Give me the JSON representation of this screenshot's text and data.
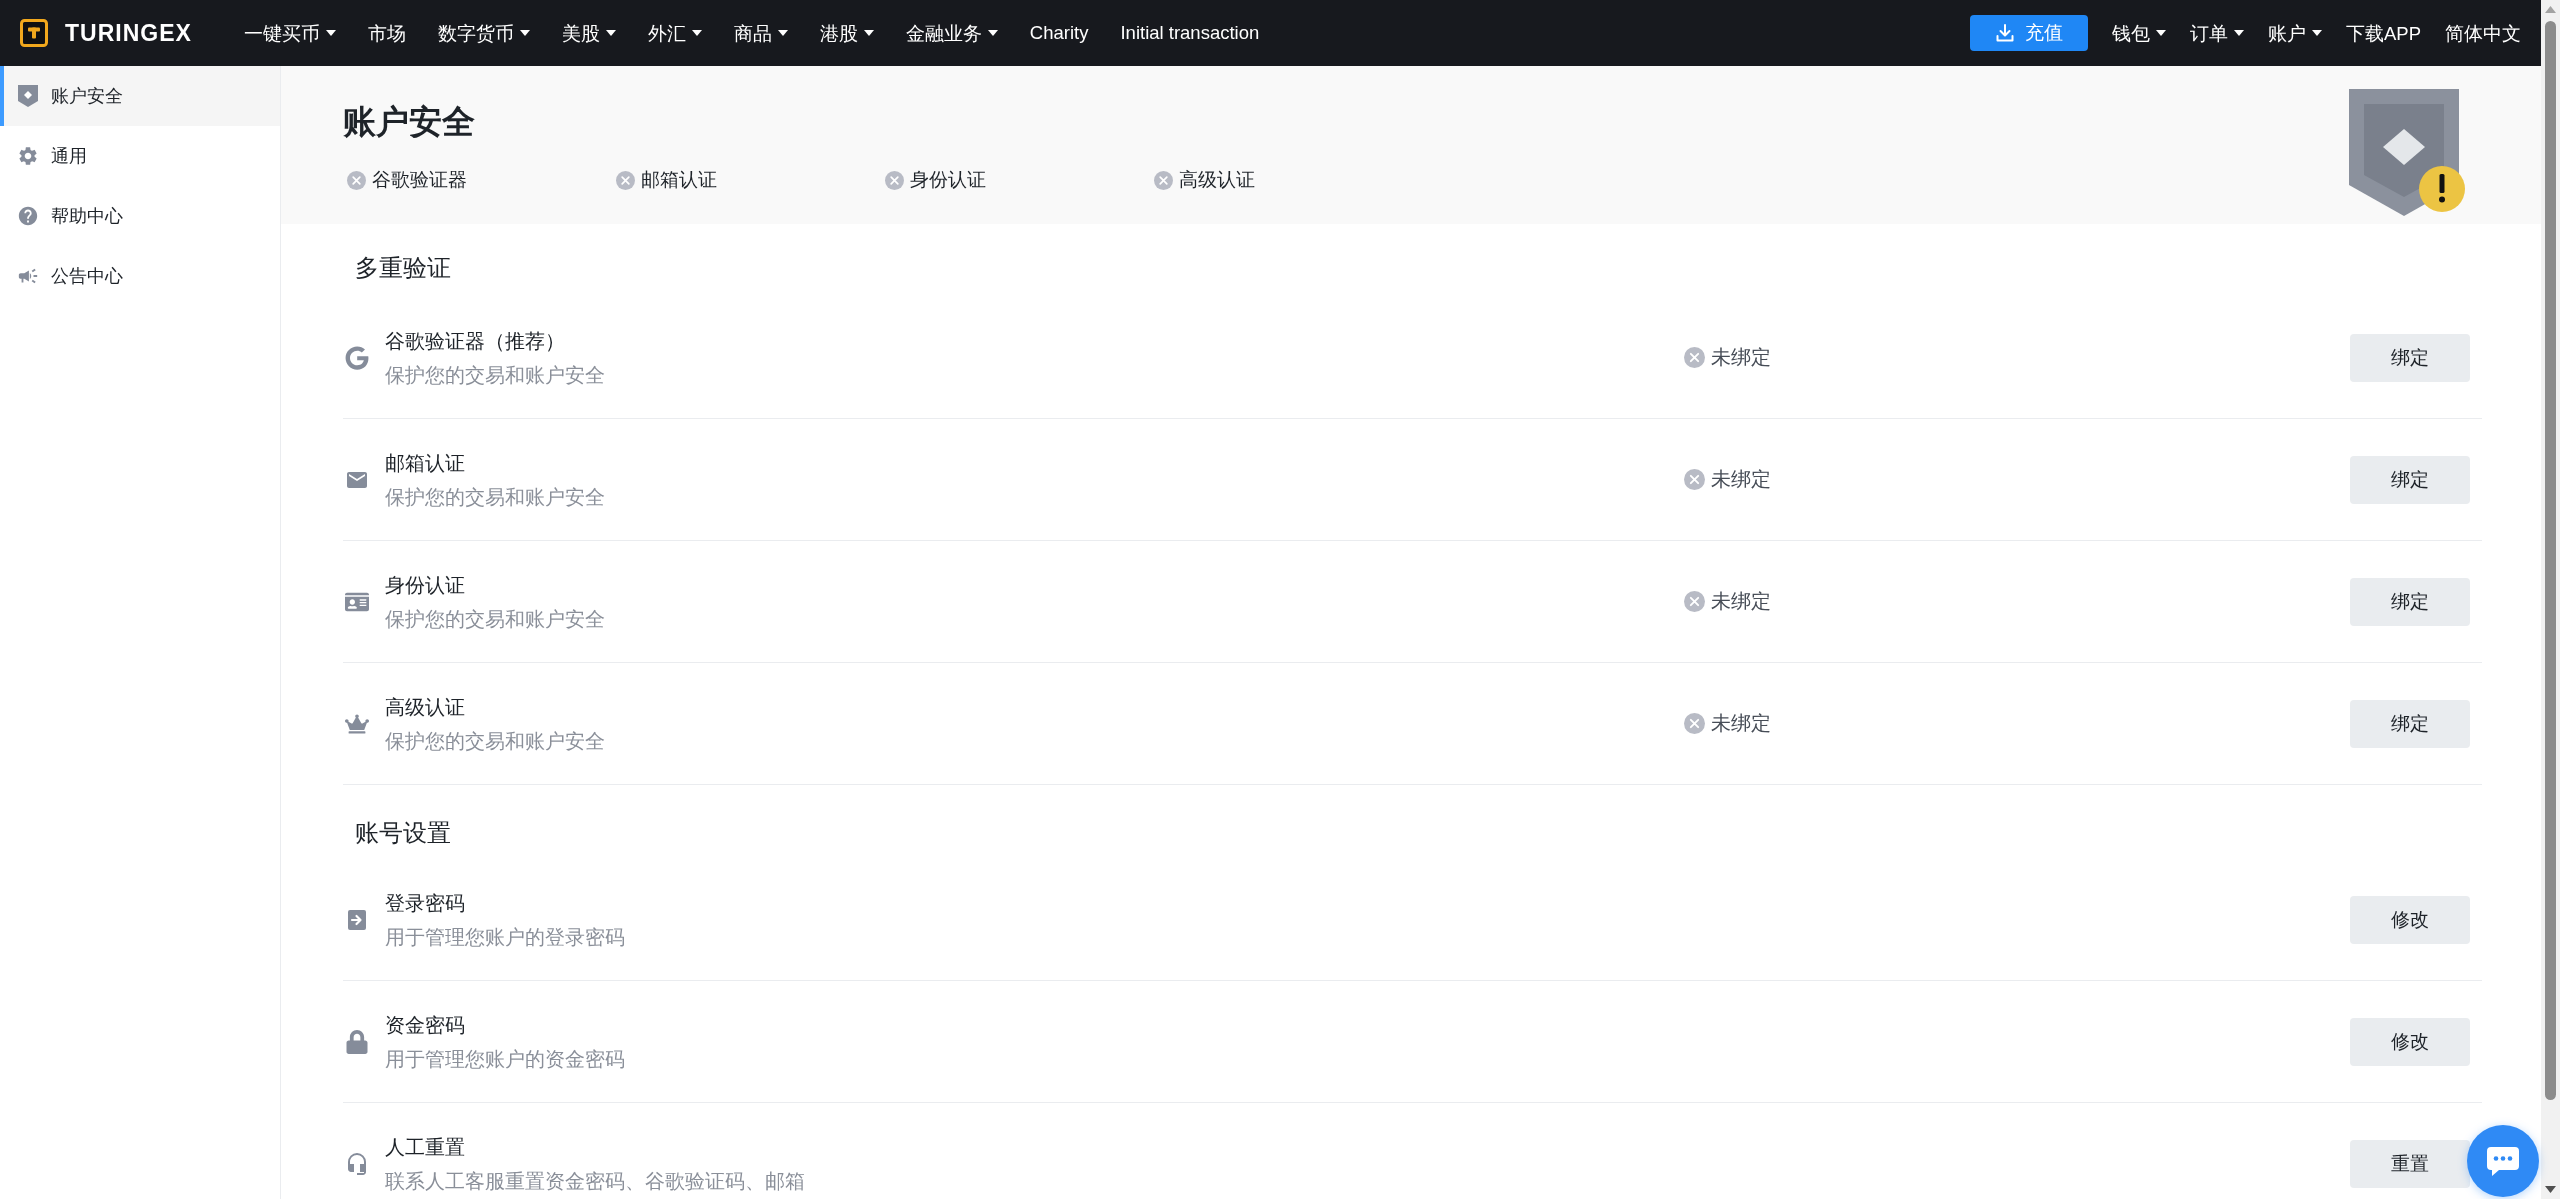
{
  "nav": {
    "logo_text": "TURINGEX",
    "items": [
      {
        "label": "一键买币",
        "dropdown": true
      },
      {
        "label": "市场",
        "dropdown": false
      },
      {
        "label": "数字货币",
        "dropdown": true
      },
      {
        "label": "美股",
        "dropdown": true
      },
      {
        "label": "外汇",
        "dropdown": true
      },
      {
        "label": "商品",
        "dropdown": true
      },
      {
        "label": "港股",
        "dropdown": true
      },
      {
        "label": "金融业务",
        "dropdown": true
      },
      {
        "label": "Charity",
        "dropdown": false
      },
      {
        "label": "Initial transaction",
        "dropdown": false
      }
    ],
    "deposit_button": "充值",
    "right_items": [
      {
        "label": "钱包",
        "dropdown": true
      },
      {
        "label": "订单",
        "dropdown": true
      },
      {
        "label": "账户",
        "dropdown": true
      },
      {
        "label": "下载APP",
        "dropdown": false
      },
      {
        "label": "简体中文",
        "dropdown": false
      }
    ]
  },
  "sidebar": {
    "items": [
      {
        "label": "账户安全",
        "selected": true
      },
      {
        "label": "通用",
        "selected": false
      },
      {
        "label": "帮助中心",
        "selected": false
      },
      {
        "label": "公告中心",
        "selected": false
      }
    ]
  },
  "header": {
    "title": "账户安全",
    "checks": [
      {
        "label": "谷歌验证器",
        "done": false
      },
      {
        "label": "邮箱认证",
        "done": false
      },
      {
        "label": "身份认证",
        "done": false
      },
      {
        "label": "高级认证",
        "done": false
      }
    ]
  },
  "sections": [
    {
      "title": "多重验证",
      "rows": [
        {
          "title": "谷歌验证器（推荐）",
          "description": "保护您的交易和账户安全",
          "status": {
            "text": "未绑定",
            "bound": false
          },
          "action": "绑定"
        },
        {
          "title": "邮箱认证",
          "description": "保护您的交易和账户安全",
          "status": {
            "text": "未绑定",
            "bound": false
          },
          "action": "绑定"
        },
        {
          "title": "身份认证",
          "description": "保护您的交易和账户安全",
          "status": {
            "text": "未绑定",
            "bound": false
          },
          "action": "绑定"
        },
        {
          "title": "高级认证",
          "description": "保护您的交易和账户安全",
          "status": {
            "text": "未绑定",
            "bound": false
          },
          "action": "绑定"
        }
      ]
    },
    {
      "title": "账号设置",
      "rows": [
        {
          "title": "登录密码",
          "description": "用于管理您账户的登录密码",
          "action": "修改"
        },
        {
          "title": "资金密码",
          "description": "用于管理您账户的资金密码",
          "action": "修改"
        },
        {
          "title": "人工重置",
          "description": "联系人工客服重置资金密码、谷歌验证码、邮箱",
          "action": "重置"
        }
      ]
    }
  ]
}
